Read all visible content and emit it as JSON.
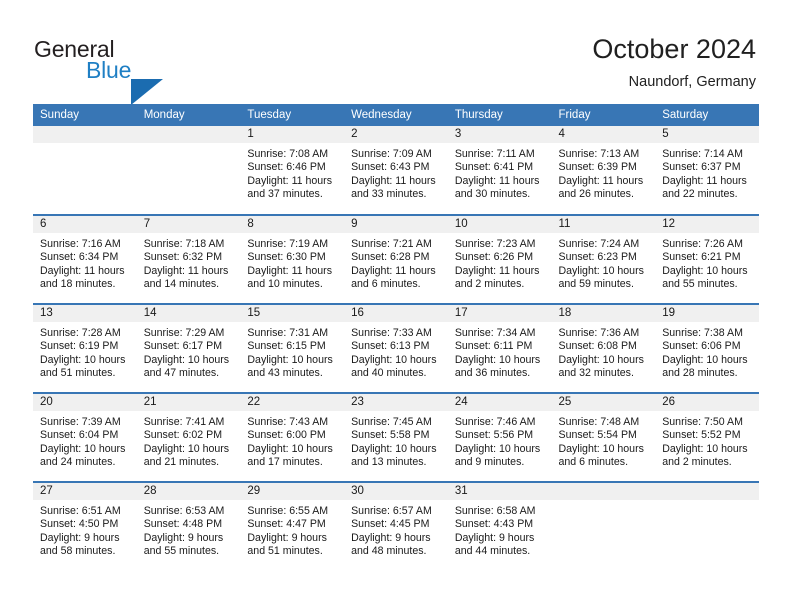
{
  "brand": {
    "name_part1": "General",
    "name_part2": "Blue",
    "triangle_color": "#1b6cb0",
    "accent_color": "#1f7fc4"
  },
  "header": {
    "title": "October 2024",
    "subtitle": "Naundorf, Germany"
  },
  "theme": {
    "header_bar_color": "#3876b5",
    "daynum_band_color": "#f0f0f0",
    "row_divider_color": "#3876b5",
    "text_color": "#1a1a1a"
  },
  "weekdays": [
    "Sunday",
    "Monday",
    "Tuesday",
    "Wednesday",
    "Thursday",
    "Friday",
    "Saturday"
  ],
  "labels": {
    "sunrise_prefix": "Sunrise: ",
    "sunset_prefix": "Sunset: ",
    "daylight_prefix": "Daylight: "
  },
  "weeks": [
    [
      {
        "day": "",
        "sunrise": "",
        "sunset": "",
        "daylight": "",
        "empty": true
      },
      {
        "day": "",
        "sunrise": "",
        "sunset": "",
        "daylight": "",
        "empty": true
      },
      {
        "day": "1",
        "sunrise": "Sunrise: 7:08 AM",
        "sunset": "Sunset: 6:46 PM",
        "daylight": "Daylight: 11 hours and 37 minutes.",
        "empty": false
      },
      {
        "day": "2",
        "sunrise": "Sunrise: 7:09 AM",
        "sunset": "Sunset: 6:43 PM",
        "daylight": "Daylight: 11 hours and 33 minutes.",
        "empty": false
      },
      {
        "day": "3",
        "sunrise": "Sunrise: 7:11 AM",
        "sunset": "Sunset: 6:41 PM",
        "daylight": "Daylight: 11 hours and 30 minutes.",
        "empty": false
      },
      {
        "day": "4",
        "sunrise": "Sunrise: 7:13 AM",
        "sunset": "Sunset: 6:39 PM",
        "daylight": "Daylight: 11 hours and 26 minutes.",
        "empty": false
      },
      {
        "day": "5",
        "sunrise": "Sunrise: 7:14 AM",
        "sunset": "Sunset: 6:37 PM",
        "daylight": "Daylight: 11 hours and 22 minutes.",
        "empty": false
      }
    ],
    [
      {
        "day": "6",
        "sunrise": "Sunrise: 7:16 AM",
        "sunset": "Sunset: 6:34 PM",
        "daylight": "Daylight: 11 hours and 18 minutes.",
        "empty": false
      },
      {
        "day": "7",
        "sunrise": "Sunrise: 7:18 AM",
        "sunset": "Sunset: 6:32 PM",
        "daylight": "Daylight: 11 hours and 14 minutes.",
        "empty": false
      },
      {
        "day": "8",
        "sunrise": "Sunrise: 7:19 AM",
        "sunset": "Sunset: 6:30 PM",
        "daylight": "Daylight: 11 hours and 10 minutes.",
        "empty": false
      },
      {
        "day": "9",
        "sunrise": "Sunrise: 7:21 AM",
        "sunset": "Sunset: 6:28 PM",
        "daylight": "Daylight: 11 hours and 6 minutes.",
        "empty": false
      },
      {
        "day": "10",
        "sunrise": "Sunrise: 7:23 AM",
        "sunset": "Sunset: 6:26 PM",
        "daylight": "Daylight: 11 hours and 2 minutes.",
        "empty": false
      },
      {
        "day": "11",
        "sunrise": "Sunrise: 7:24 AM",
        "sunset": "Sunset: 6:23 PM",
        "daylight": "Daylight: 10 hours and 59 minutes.",
        "empty": false
      },
      {
        "day": "12",
        "sunrise": "Sunrise: 7:26 AM",
        "sunset": "Sunset: 6:21 PM",
        "daylight": "Daylight: 10 hours and 55 minutes.",
        "empty": false
      }
    ],
    [
      {
        "day": "13",
        "sunrise": "Sunrise: 7:28 AM",
        "sunset": "Sunset: 6:19 PM",
        "daylight": "Daylight: 10 hours and 51 minutes.",
        "empty": false
      },
      {
        "day": "14",
        "sunrise": "Sunrise: 7:29 AM",
        "sunset": "Sunset: 6:17 PM",
        "daylight": "Daylight: 10 hours and 47 minutes.",
        "empty": false
      },
      {
        "day": "15",
        "sunrise": "Sunrise: 7:31 AM",
        "sunset": "Sunset: 6:15 PM",
        "daylight": "Daylight: 10 hours and 43 minutes.",
        "empty": false
      },
      {
        "day": "16",
        "sunrise": "Sunrise: 7:33 AM",
        "sunset": "Sunset: 6:13 PM",
        "daylight": "Daylight: 10 hours and 40 minutes.",
        "empty": false
      },
      {
        "day": "17",
        "sunrise": "Sunrise: 7:34 AM",
        "sunset": "Sunset: 6:11 PM",
        "daylight": "Daylight: 10 hours and 36 minutes.",
        "empty": false
      },
      {
        "day": "18",
        "sunrise": "Sunrise: 7:36 AM",
        "sunset": "Sunset: 6:08 PM",
        "daylight": "Daylight: 10 hours and 32 minutes.",
        "empty": false
      },
      {
        "day": "19",
        "sunrise": "Sunrise: 7:38 AM",
        "sunset": "Sunset: 6:06 PM",
        "daylight": "Daylight: 10 hours and 28 minutes.",
        "empty": false
      }
    ],
    [
      {
        "day": "20",
        "sunrise": "Sunrise: 7:39 AM",
        "sunset": "Sunset: 6:04 PM",
        "daylight": "Daylight: 10 hours and 24 minutes.",
        "empty": false
      },
      {
        "day": "21",
        "sunrise": "Sunrise: 7:41 AM",
        "sunset": "Sunset: 6:02 PM",
        "daylight": "Daylight: 10 hours and 21 minutes.",
        "empty": false
      },
      {
        "day": "22",
        "sunrise": "Sunrise: 7:43 AM",
        "sunset": "Sunset: 6:00 PM",
        "daylight": "Daylight: 10 hours and 17 minutes.",
        "empty": false
      },
      {
        "day": "23",
        "sunrise": "Sunrise: 7:45 AM",
        "sunset": "Sunset: 5:58 PM",
        "daylight": "Daylight: 10 hours and 13 minutes.",
        "empty": false
      },
      {
        "day": "24",
        "sunrise": "Sunrise: 7:46 AM",
        "sunset": "Sunset: 5:56 PM",
        "daylight": "Daylight: 10 hours and 9 minutes.",
        "empty": false
      },
      {
        "day": "25",
        "sunrise": "Sunrise: 7:48 AM",
        "sunset": "Sunset: 5:54 PM",
        "daylight": "Daylight: 10 hours and 6 minutes.",
        "empty": false
      },
      {
        "day": "26",
        "sunrise": "Sunrise: 7:50 AM",
        "sunset": "Sunset: 5:52 PM",
        "daylight": "Daylight: 10 hours and 2 minutes.",
        "empty": false
      }
    ],
    [
      {
        "day": "27",
        "sunrise": "Sunrise: 6:51 AM",
        "sunset": "Sunset: 4:50 PM",
        "daylight": "Daylight: 9 hours and 58 minutes.",
        "empty": false
      },
      {
        "day": "28",
        "sunrise": "Sunrise: 6:53 AM",
        "sunset": "Sunset: 4:48 PM",
        "daylight": "Daylight: 9 hours and 55 minutes.",
        "empty": false
      },
      {
        "day": "29",
        "sunrise": "Sunrise: 6:55 AM",
        "sunset": "Sunset: 4:47 PM",
        "daylight": "Daylight: 9 hours and 51 minutes.",
        "empty": false
      },
      {
        "day": "30",
        "sunrise": "Sunrise: 6:57 AM",
        "sunset": "Sunset: 4:45 PM",
        "daylight": "Daylight: 9 hours and 48 minutes.",
        "empty": false
      },
      {
        "day": "31",
        "sunrise": "Sunrise: 6:58 AM",
        "sunset": "Sunset: 4:43 PM",
        "daylight": "Daylight: 9 hours and 44 minutes.",
        "empty": false
      },
      {
        "day": "",
        "sunrise": "",
        "sunset": "",
        "daylight": "",
        "empty": true
      },
      {
        "day": "",
        "sunrise": "",
        "sunset": "",
        "daylight": "",
        "empty": true
      }
    ]
  ]
}
